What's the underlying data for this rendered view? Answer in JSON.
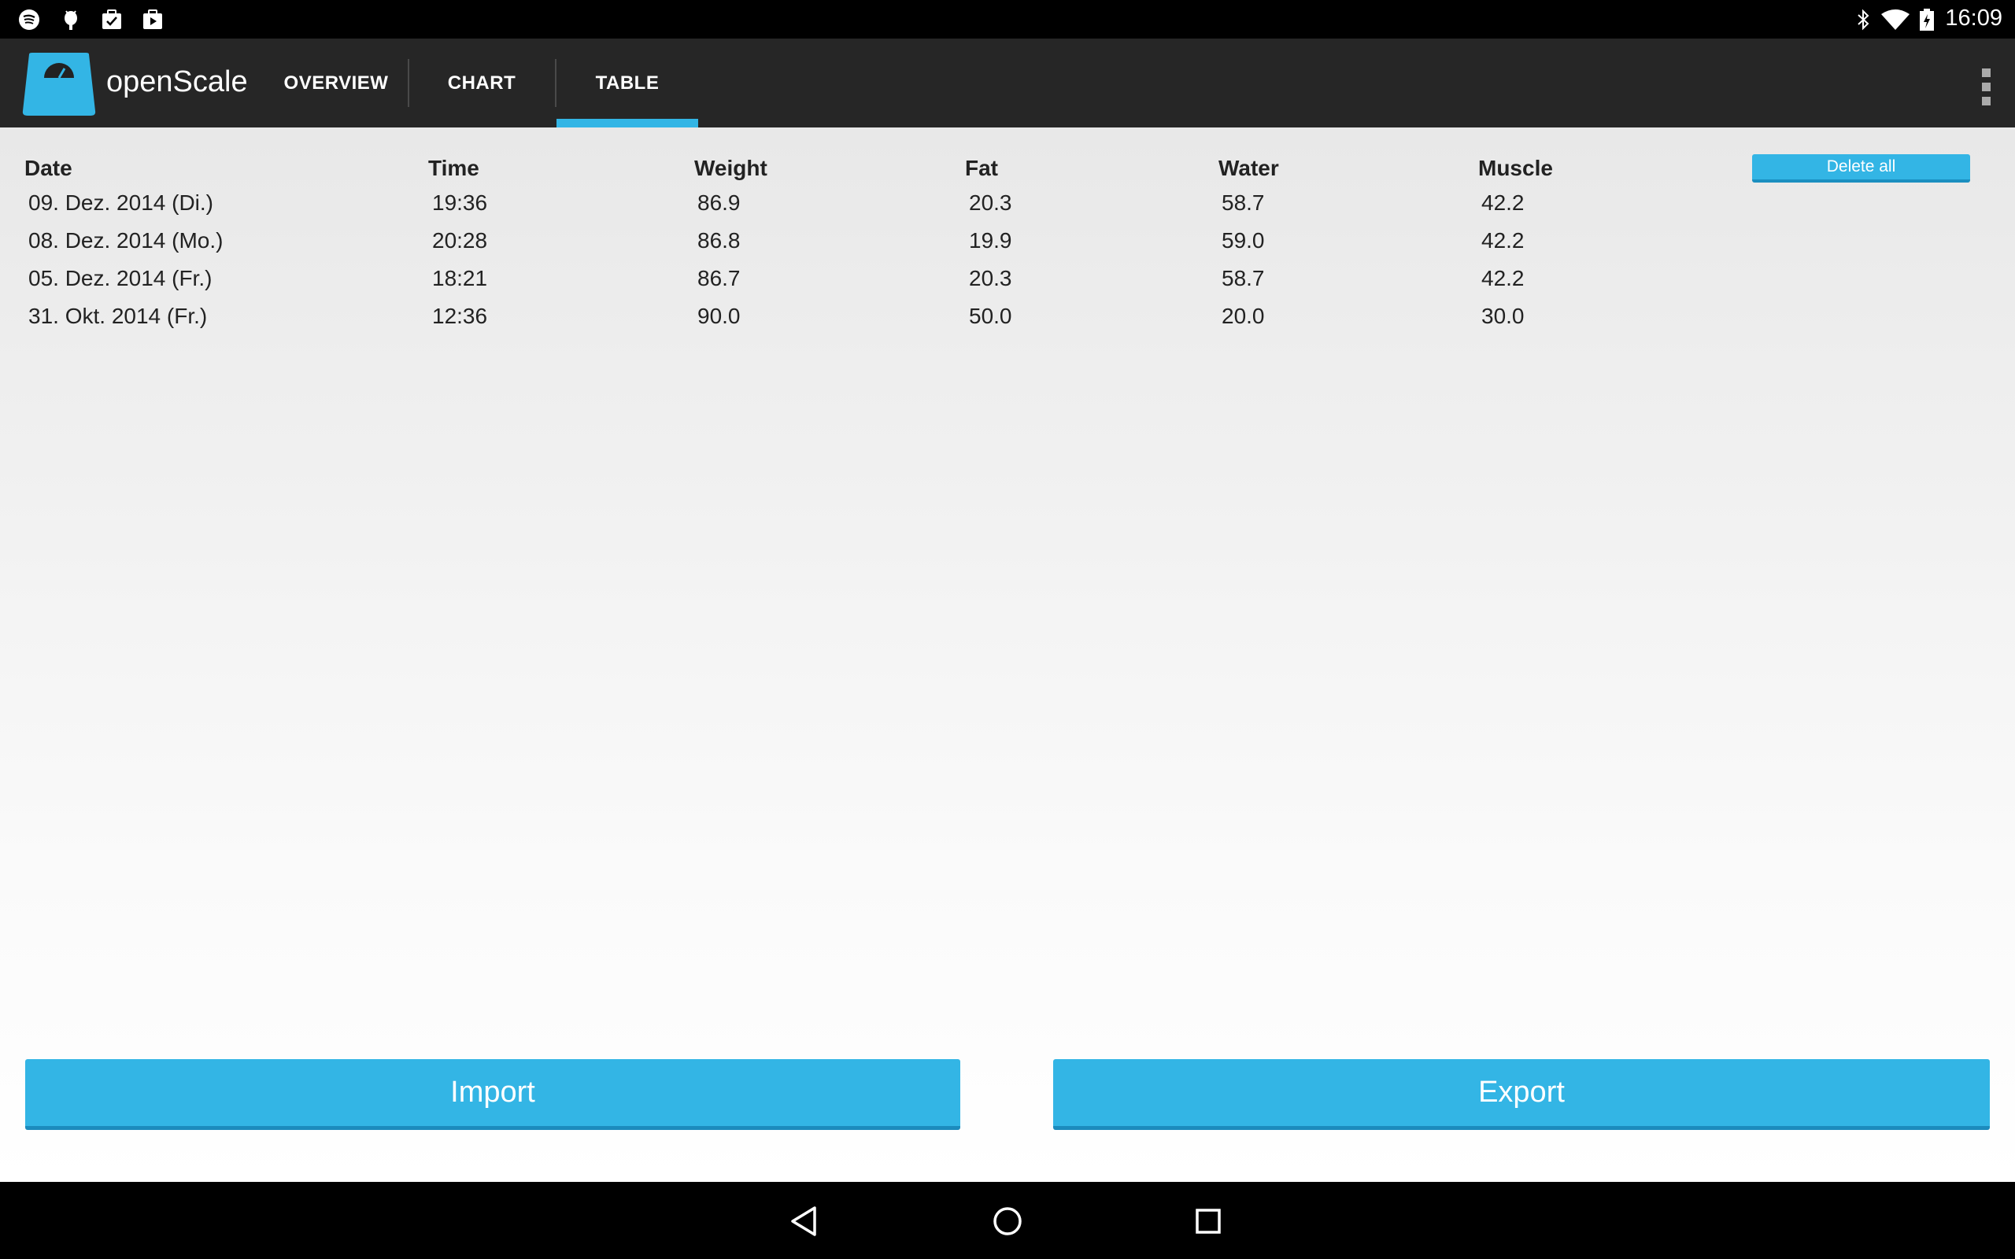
{
  "status_bar": {
    "time": "16:09",
    "left_icons": [
      "spotify-icon",
      "android-debug-icon",
      "task-check-icon",
      "play-store-icon"
    ],
    "right_icons": [
      "bluetooth-icon",
      "wifi-icon",
      "battery-charging-icon"
    ]
  },
  "app": {
    "title": "openScale",
    "tabs": [
      {
        "label": "OVERVIEW",
        "active": false
      },
      {
        "label": "CHART",
        "active": false
      },
      {
        "label": "TABLE",
        "active": true
      }
    ],
    "accent_color": "#33b5e5"
  },
  "table": {
    "headers": [
      "Date",
      "Time",
      "Weight",
      "Fat",
      "Water",
      "Muscle"
    ],
    "rows": [
      [
        "09. Dez. 2014 (Di.)",
        "19:36",
        "86.9",
        "20.3",
        "58.7",
        "42.2"
      ],
      [
        "08. Dez. 2014 (Mo.)",
        "20:28",
        "86.8",
        "19.9",
        "59.0",
        "42.2"
      ],
      [
        "05. Dez. 2014 (Fr.)",
        "18:21",
        "86.7",
        "20.3",
        "58.7",
        "42.2"
      ],
      [
        "31. Okt. 2014 (Fr.)",
        "12:36",
        "90.0",
        "50.0",
        "20.0",
        "30.0"
      ]
    ],
    "delete_all_label": "Delete all"
  },
  "actions": {
    "import_label": "Import",
    "export_label": "Export"
  },
  "nav": [
    "back-icon",
    "home-icon",
    "recents-icon"
  ]
}
